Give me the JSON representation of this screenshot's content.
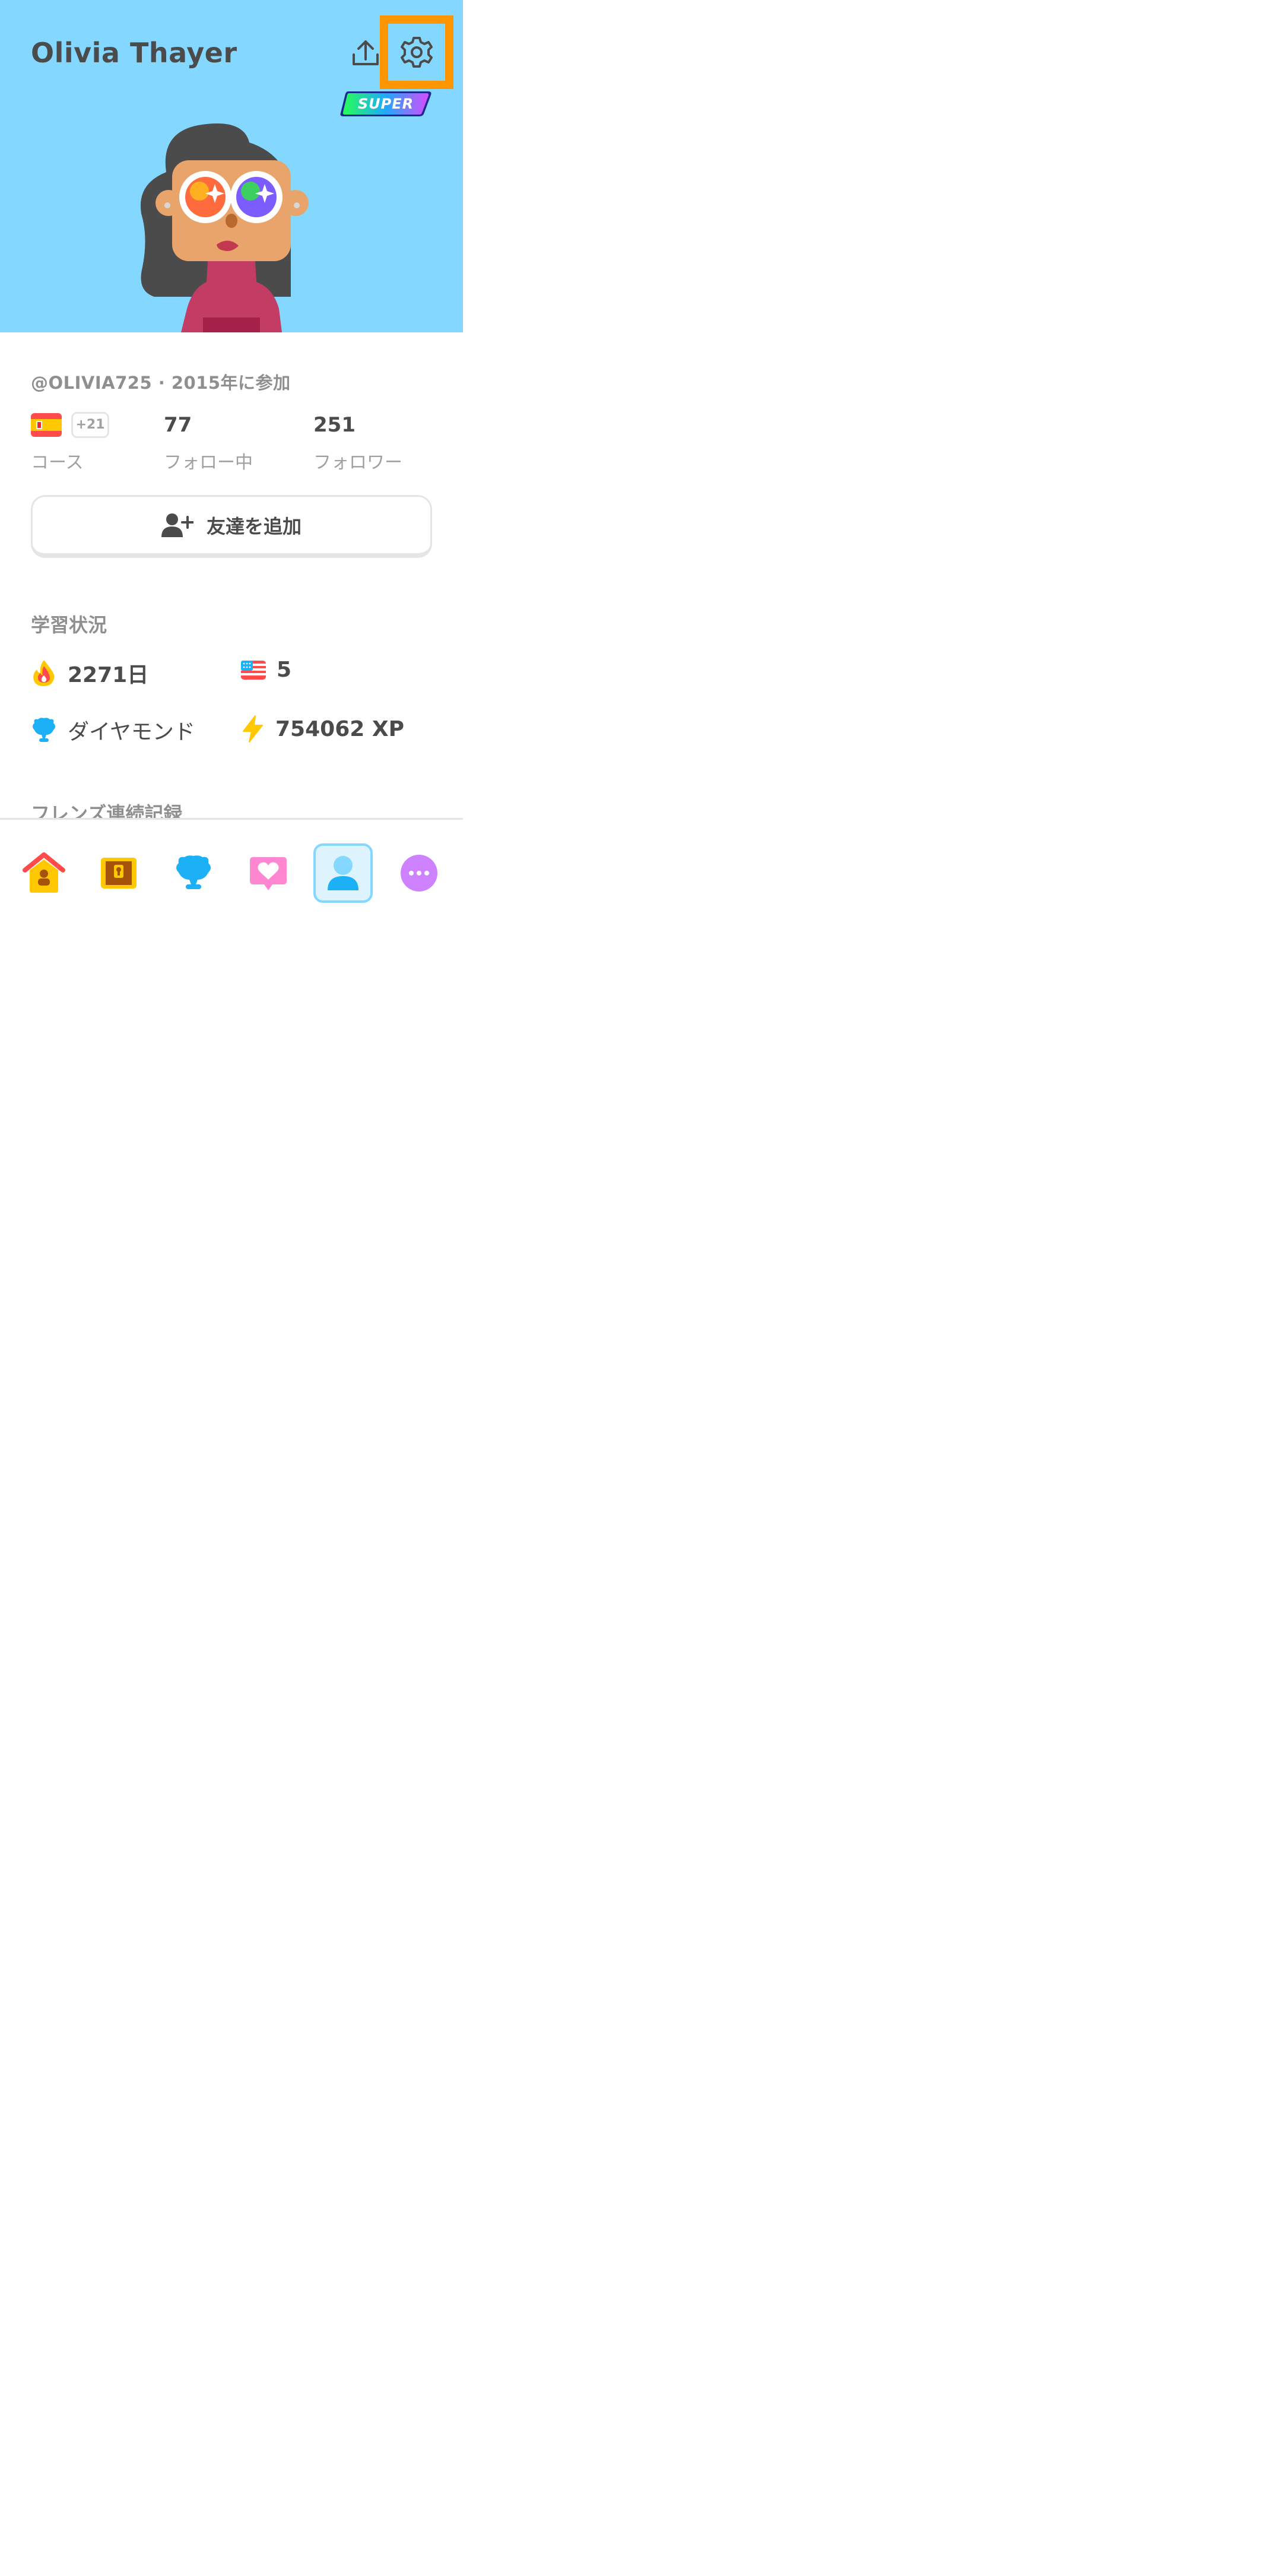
{
  "profile": {
    "name": "Olivia Thayer",
    "badge": "SUPER",
    "meta": "@OLIVIA725 · 2015年に参加"
  },
  "stats": {
    "courses_extra": "+21",
    "courses_label": "コース",
    "following_count": "77",
    "following_label": "フォロー中",
    "followers_count": "251",
    "followers_label": "フォロワー"
  },
  "add_friend_label": "友達を追加",
  "progress": {
    "title": "学習状況",
    "streak": "2271日",
    "flag_count": "5",
    "league": "ダイヤモンド",
    "xp": "754062 XP"
  },
  "friends_section_title": "フレンズ連続記録",
  "icons": {
    "share": "share-icon",
    "settings": "gear-icon",
    "course_flag": "spain-flag-icon",
    "streak": "fire-icon",
    "us_flag": "us-flag-icon",
    "league": "diamond-trophy-icon",
    "xp": "lightning-icon"
  },
  "nav": {
    "items": [
      "home",
      "treasure-chest",
      "leaderboards",
      "hearts",
      "profile",
      "more"
    ],
    "active": "profile"
  },
  "colors": {
    "header_bg": "#84d8ff",
    "highlight": "#ff9600",
    "nav_active_bg": "#ddf4ff",
    "nav_active_border": "#84d8ff"
  }
}
